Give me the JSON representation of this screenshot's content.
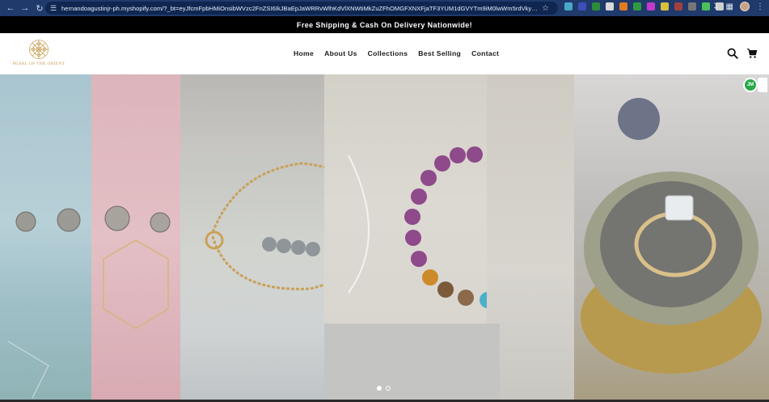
{
  "browser": {
    "url": "hernandoagustinjr-ph.myshopify.com/?_bt=eyJfcmFpbHMiOnsibWVzc2FnZSI6IkJBaEpJaWRRvWlhKdVlXNWtiMkZuZFhOMGFXNXFjaTF3YUM1dGVYTm9iM0lwWm5rdVkyOXRCam9HUlZRPSIsIm...",
    "extension_colors": [
      "#4aa7c7",
      "#3d4fb8",
      "#2e8b3a",
      "#d9d9d9",
      "#e07b1f",
      "#2f9b3f",
      "#c63ac9",
      "#d8c23d",
      "#a04040",
      "#777777",
      "#48c15a",
      "#cfcfcf"
    ]
  },
  "announcement": {
    "text": "Free Shipping & Cash On Delivery Nationwide!"
  },
  "header": {
    "logo_text": "PEARL OF THE ORIENT",
    "logo_color": "#c9a15a",
    "menu": [
      {
        "label": "Home"
      },
      {
        "label": "About Us"
      },
      {
        "label": "Collections"
      },
      {
        "label": "Best Selling"
      },
      {
        "label": "Contact"
      }
    ],
    "icons": [
      "search-icon",
      "cart-icon"
    ]
  },
  "hero": {
    "slide_count": 2,
    "active_slide": 1
  },
  "badge": {
    "text": "JM",
    "color": "#2aa84a"
  }
}
